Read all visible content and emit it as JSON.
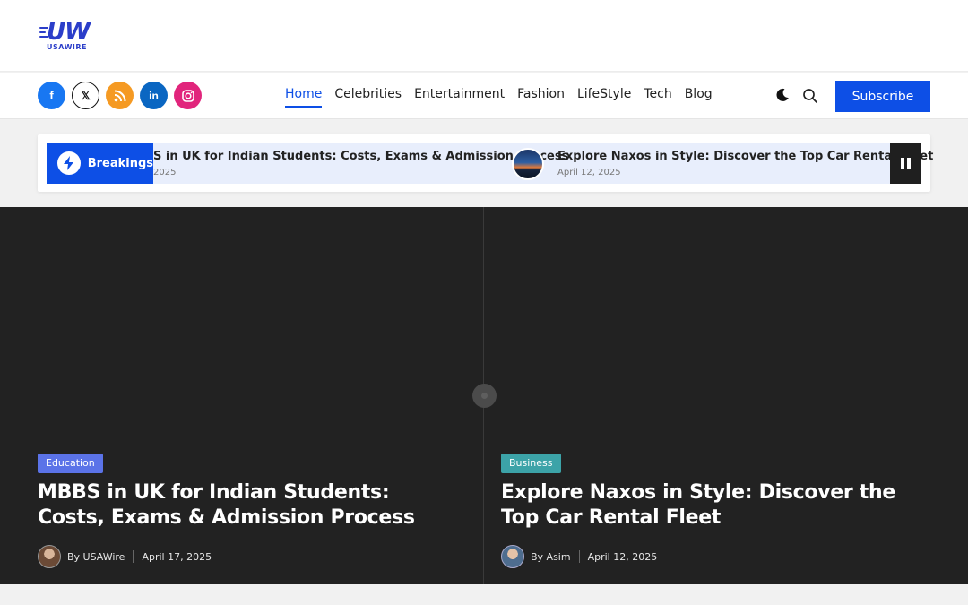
{
  "logo": {
    "mark": "UW",
    "name": "USAWIRE"
  },
  "socials": [
    {
      "name": "facebook",
      "glyph": "f"
    },
    {
      "name": "x",
      "glyph": "𝕏"
    },
    {
      "name": "rss",
      "glyph": "◉"
    },
    {
      "name": "linkedin",
      "glyph": "in"
    },
    {
      "name": "instagram",
      "glyph": "◎"
    }
  ],
  "menu": [
    "Home",
    "Celebrities",
    "Entertainment",
    "Fashion",
    "LifeStyle",
    "Tech",
    "Blog"
  ],
  "menu_active": "Home",
  "subscribe_label": "Subscribe",
  "breaking": {
    "label": "Breakings",
    "items": [
      {
        "title": "S in UK for Indian Students: Costs, Exams & Admission Process",
        "date": "2025"
      },
      {
        "title": "Explore Naxos in Style: Discover the Top Car Rental Fleet",
        "date": "April 12, 2025"
      }
    ]
  },
  "featured": [
    {
      "category": "Education",
      "title": "MBBS in UK for Indian Students: Costs, Exams & Admission Process",
      "author": "By USAWire",
      "date": "April 17, 2025"
    },
    {
      "category": "Business",
      "title": "Explore Naxos in Style: Discover the Top Car Rental Fleet",
      "author": "By Asim",
      "date": "April 12, 2025"
    }
  ],
  "colors": {
    "accent": "#0d4fe6",
    "hero_bg": "#222222",
    "education_tag": "#5b73e8",
    "business_tag": "#3ca3a8"
  }
}
